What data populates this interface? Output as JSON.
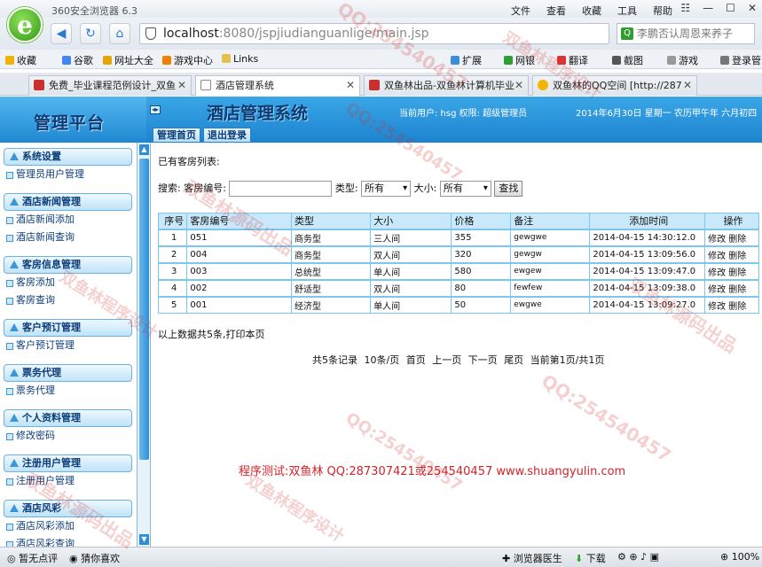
{
  "browser": {
    "app_title": "360安全浏览器 6.3",
    "menu": [
      "文件",
      "查看",
      "收藏",
      "工具",
      "帮助"
    ],
    "url_host": "localhost",
    "url_rest": ":8080/jspjiudianguanlige/main.jsp",
    "search_placeholder": "李鹏否认周恩来养子",
    "bookmarks": [
      "收藏",
      "谷歌",
      "网址大全",
      "游戏中心",
      "Links",
      "扩展",
      "网银",
      "翻译",
      "截图",
      "游戏",
      "登录管"
    ],
    "tabs": [
      {
        "label": "免费_毕业课程范例设计_双鱼"
      },
      {
        "label": "酒店管理系统"
      },
      {
        "label": "双鱼林出品-双鱼林计算机毕业"
      },
      {
        "label": "双鱼林的QQ空间 [http://287"
      }
    ],
    "status": {
      "left1": "暂无点评",
      "left2": "猜你喜欢",
      "doctor": "浏览器医生",
      "download": "下载",
      "zoom": "100%"
    }
  },
  "header": {
    "brand": "管理平台",
    "title": "酒店管理系统",
    "user_info": "当前用户: hsg 权限: 超级管理员",
    "date_info": "2014年6月30日 星期一 农历甲午年 六月初四",
    "nav": [
      "管理首页",
      "退出登录"
    ]
  },
  "sidebar": {
    "groups": [
      {
        "title": "系统设置",
        "items": [
          "管理员用户管理"
        ]
      },
      {
        "title": "酒店新闻管理",
        "items": [
          "酒店新闻添加",
          "酒店新闻查询"
        ]
      },
      {
        "title": "客房信息管理",
        "items": [
          "客房添加",
          "客房查询"
        ]
      },
      {
        "title": "客户预订管理",
        "items": [
          "客户预订管理"
        ]
      },
      {
        "title": "票务代理",
        "items": [
          "票务代理"
        ]
      },
      {
        "title": "个人资料管理",
        "items": [
          "修改密码"
        ]
      },
      {
        "title": "注册用户管理",
        "items": [
          "注册用户管理"
        ]
      },
      {
        "title": "酒店风彩",
        "items": [
          "酒店风彩添加",
          "酒店风彩查询"
        ]
      }
    ]
  },
  "main": {
    "list_heading": "已有客房列表:",
    "search": {
      "label": "搜索: 客房编号:",
      "type_label": "类型:",
      "type_value": "所有",
      "size_label": "大小:",
      "size_value": "所有",
      "button": "查找"
    },
    "columns": [
      "序号",
      "客房编号",
      "类型",
      "大小",
      "价格",
      "备注",
      "添加时间",
      "操作"
    ],
    "rows": [
      [
        "1",
        "051",
        "商务型",
        "三人间",
        "355",
        "gewgwe",
        "2014-04-15 14:30:12.0",
        "修改 删除"
      ],
      [
        "2",
        "004",
        "商务型",
        "双人间",
        "320",
        "gewgw",
        "2014-04-15 13:09:56.0",
        "修改 删除"
      ],
      [
        "3",
        "003",
        "总统型",
        "单人间",
        "580",
        "ewgew",
        "2014-04-15 13:09:47.0",
        "修改 删除"
      ],
      [
        "4",
        "002",
        "舒适型",
        "双人间",
        "80",
        "fewfew",
        "2014-04-15 13:09:38.0",
        "修改 删除"
      ],
      [
        "5",
        "001",
        "经济型",
        "单人间",
        "50",
        "ewgwe",
        "2014-04-15 13:09:27.0",
        "修改 删除"
      ]
    ],
    "summary": "以上数据共5条,打印本页",
    "pager": "共5条记录  10条/页  首页  上一页  下一页  尾页  当前第1页/共1页",
    "test_line": "程序测试:双鱼林 QQ:287307421或254540457 www.shuangyulin.com"
  },
  "watermarks": [
    "QQ:254540457",
    "双鱼林程序设计",
    "双鱼林源码出品",
    "QQ:254540457",
    "双鱼林程序设计",
    "QQ:254540457",
    "双鱼林源码出品",
    "QQ:254540457",
    "双鱼林程序设计",
    "双鱼林源码出品"
  ]
}
